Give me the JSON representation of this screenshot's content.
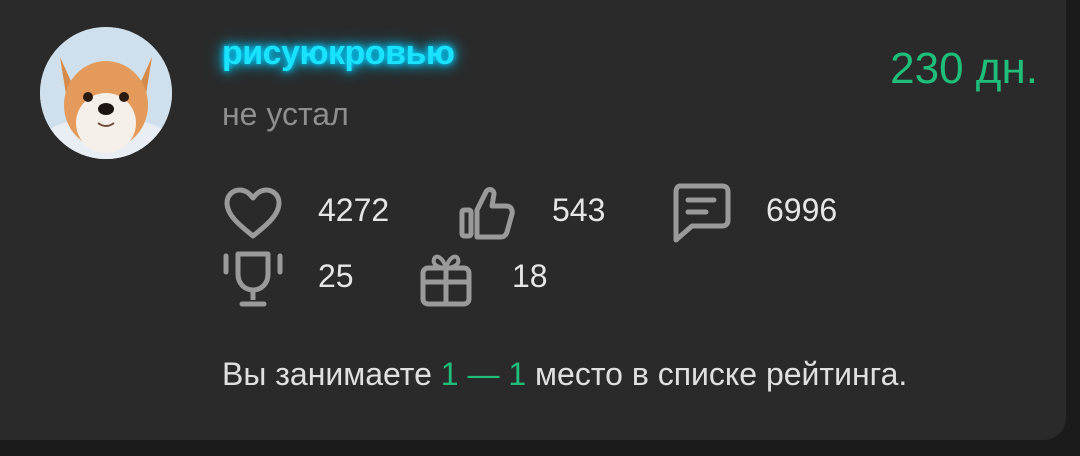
{
  "profile": {
    "username": "рисуюкровью",
    "status": "не устал",
    "days": "230 дн."
  },
  "stats": {
    "likes": "4272",
    "thumbs_up": "543",
    "comments": "6996",
    "trophies": "25",
    "gifts": "18"
  },
  "rating": {
    "prefix": "Вы занимаете",
    "place_range": "1 — 1",
    "suffix": "место в списке рейтинга."
  },
  "colors": {
    "accent_green": "#1fbe7a",
    "username_glow": "#19e3ff",
    "card_bg": "#2a2a2a"
  },
  "icons": [
    "heart-icon",
    "thumbs-up-icon",
    "comment-icon",
    "trophy-icon",
    "gift-icon"
  ]
}
